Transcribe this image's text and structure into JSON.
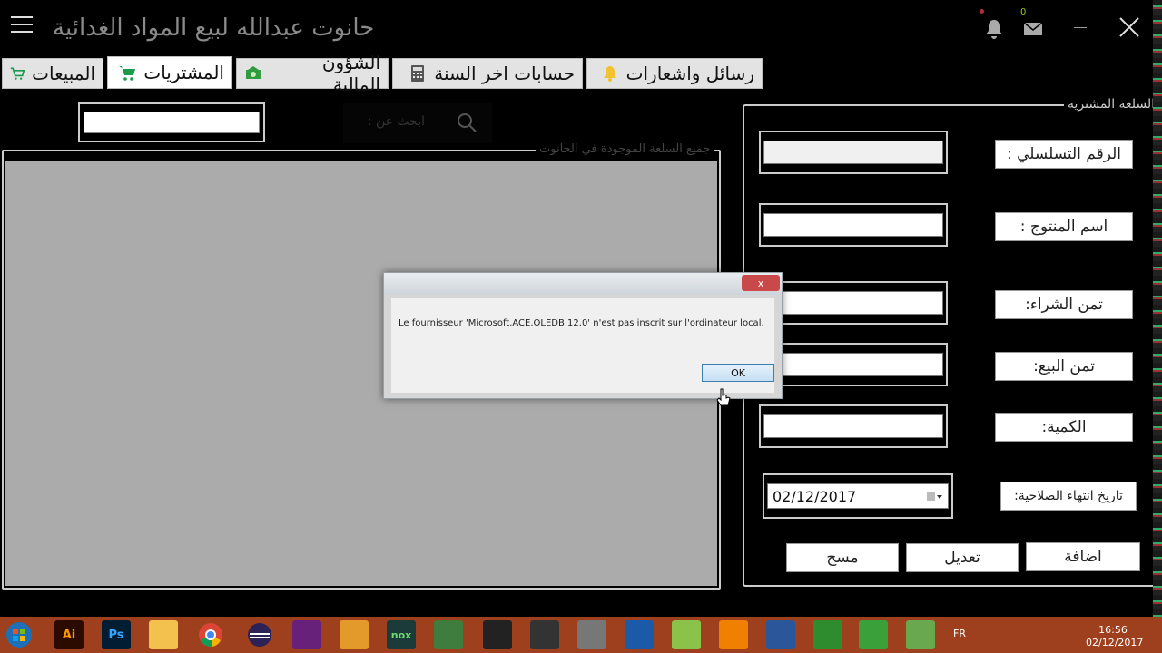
{
  "app": {
    "title": "حانوت عبدالله لبيع المواد الغدائية",
    "notifications_count": "0"
  },
  "tabs": [
    {
      "label": "المبيعات",
      "icon": "cart-icon"
    },
    {
      "label": "المشتريات",
      "icon": "shopping-cart-icon"
    },
    {
      "label": "الشؤون المالية",
      "icon": "money-icon"
    },
    {
      "label": "حسابات اخر السنة",
      "icon": "calculator-icon"
    },
    {
      "label": "رسائل واشعارات",
      "icon": "bell-icon"
    }
  ],
  "left_panel": {
    "search_placeholder": "ابحث عن :",
    "products_group_label": "جميع السلعة الموجودة في الحانوت"
  },
  "form": {
    "group_label": "السلعة المشترية",
    "serial_label": "الرقم التسلسلي :",
    "product_name_label": "اسم المنتوج :",
    "purchase_price_label": "تمن الشراء:",
    "sale_price_label": "تمن البيع:",
    "quantity_label": "الكمية:",
    "expiry_label": "تاريخ انتهاء الصلاحية:",
    "expiry_value": "02/12/2017",
    "add_button": "اضافة",
    "edit_button": "تعديل",
    "delete_button": "مسح"
  },
  "dialog": {
    "message": "Le fournisseur 'Microsoft.ACE.OLEDB.12.0' n'est pas inscrit sur l'ordinateur local.",
    "ok_label": "OK",
    "close_label": "x"
  },
  "taskbar": {
    "language": "FR",
    "time": "16:56",
    "date": "02/12/2017",
    "apps": [
      "start",
      "illustrator",
      "photoshop",
      "file-explorer",
      "chrome",
      "eclipse",
      "visual-studio",
      "package",
      "nox",
      "android-studio",
      "unity",
      "app-square",
      "sql",
      "virtualbox",
      "notepad-plus",
      "vlc",
      "word",
      "codeblocks-c",
      "codeblocks",
      "app-green"
    ]
  }
}
